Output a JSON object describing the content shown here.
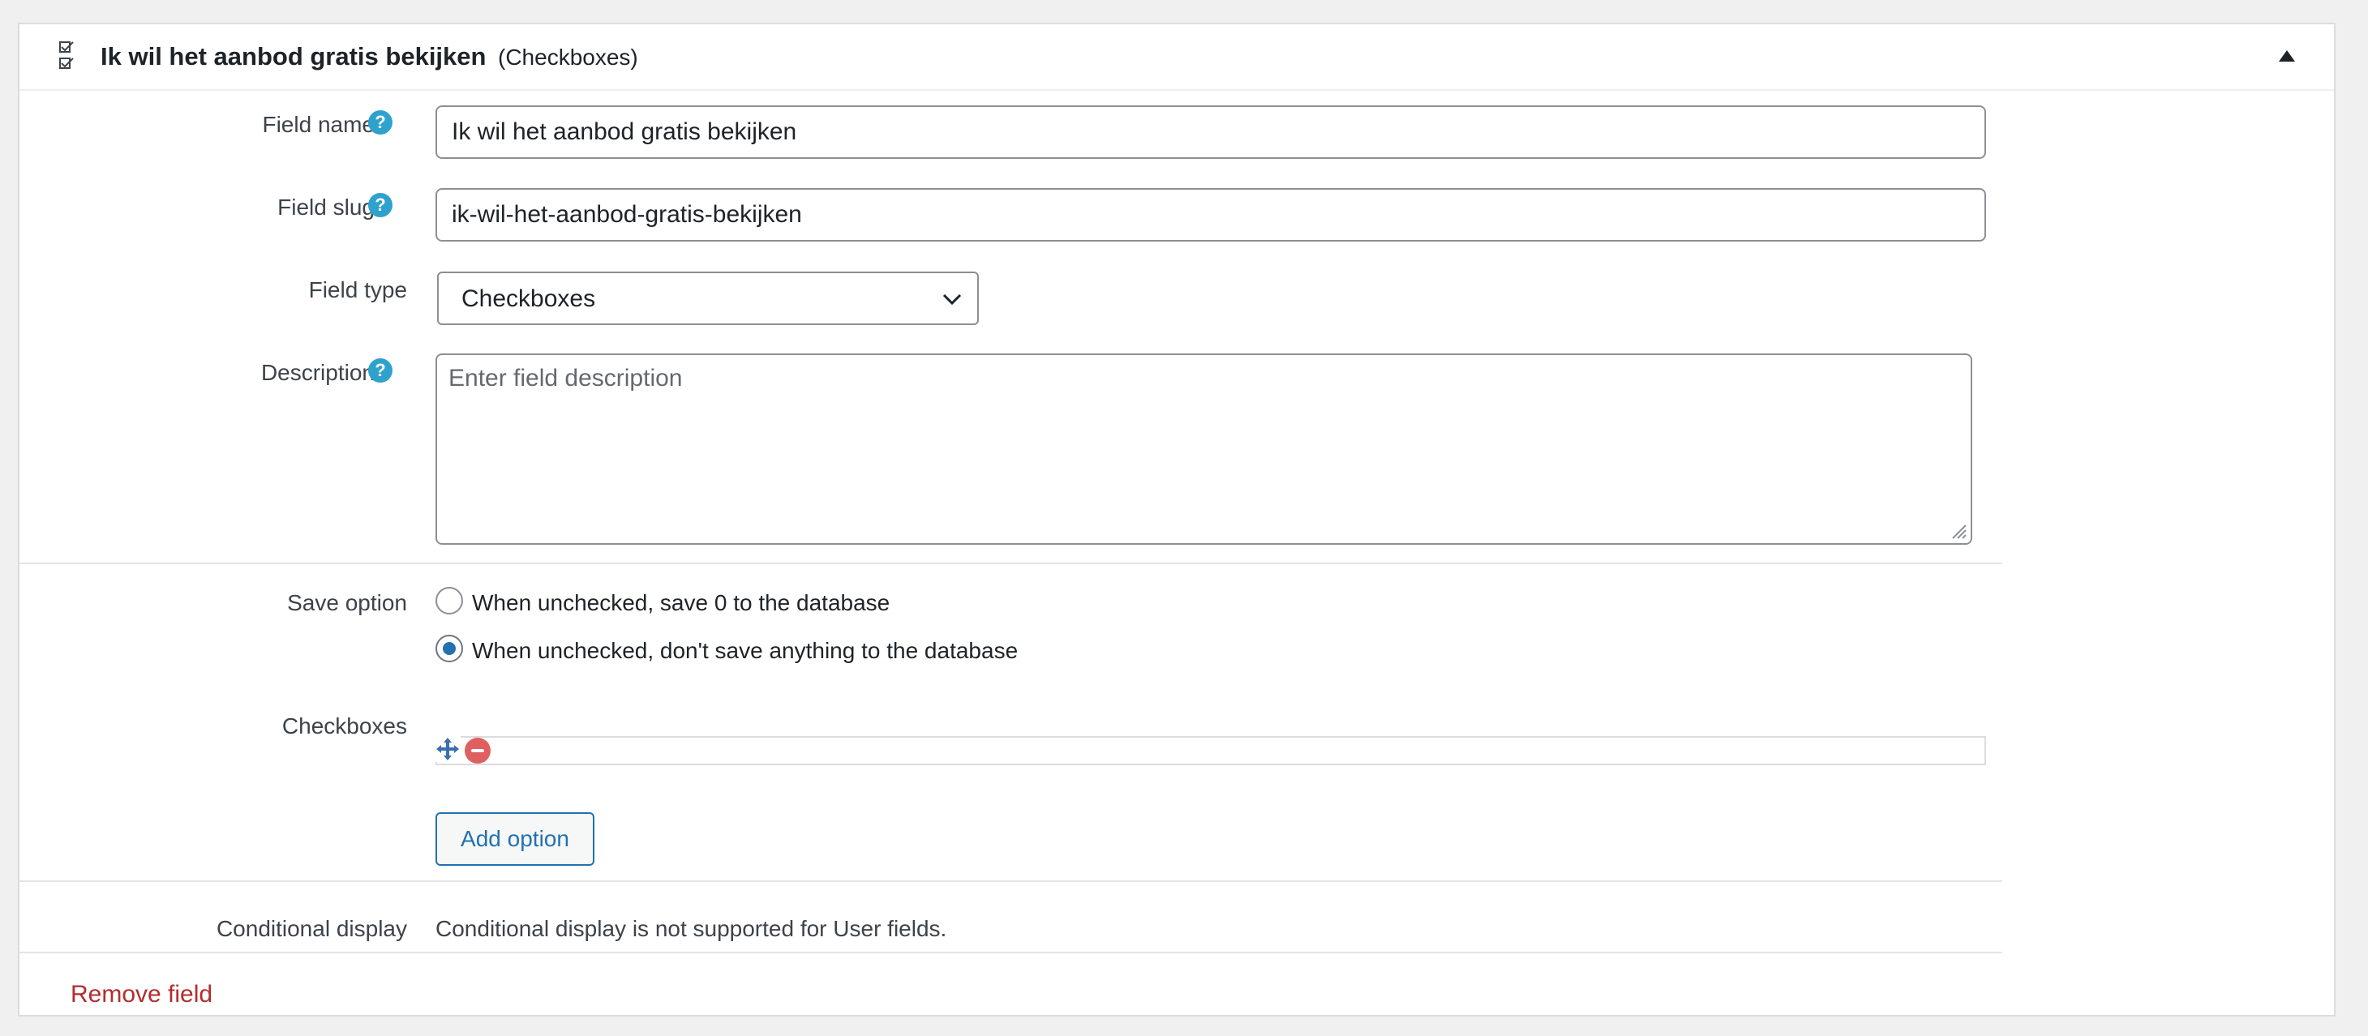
{
  "header": {
    "title": "Ik wil het aanbod gratis bekijken",
    "type_label": "(Checkboxes)",
    "icon": "checklist-icon",
    "collapse_icon": "triangle-up-icon"
  },
  "fields": {
    "name": {
      "label": "Field name",
      "value": "Ik wil het aanbod gratis bekijken",
      "help": "?"
    },
    "slug": {
      "label": "Field slug",
      "value": "ik-wil-het-aanbod-gratis-bekijken",
      "help": "?"
    },
    "type": {
      "label": "Field type",
      "value": "Checkboxes"
    },
    "description": {
      "label": "Description",
      "placeholder": "Enter field description",
      "help": "?"
    }
  },
  "save_option": {
    "label": "Save option",
    "options": [
      {
        "label": "When unchecked, save 0 to the database",
        "checked": false
      },
      {
        "label": "When unchecked, don't save anything to the database",
        "checked": true
      }
    ]
  },
  "checkboxes": {
    "label": "Checkboxes",
    "add_button": "Add option"
  },
  "conditional": {
    "label": "Conditional display",
    "text": "Conditional display is not supported for User fields."
  },
  "footer": {
    "remove_link": "Remove field"
  },
  "colors": {
    "accent": "#2271b1",
    "help": "#2ea2cc",
    "danger": "#b32d2e"
  }
}
